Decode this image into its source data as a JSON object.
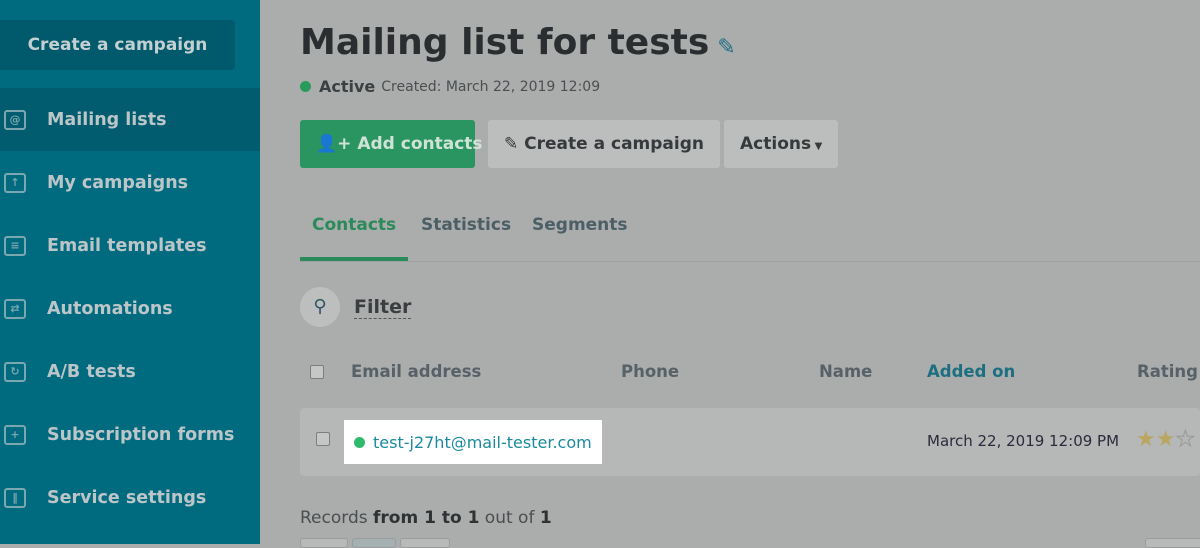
{
  "sidebar": {
    "create_button": "Create a campaign",
    "items": [
      {
        "label": "Mailing lists",
        "icon": "address-book-icon",
        "active": true
      },
      {
        "label": "My campaigns",
        "icon": "upload-icon"
      },
      {
        "label": "Email templates",
        "icon": "template-icon"
      },
      {
        "label": "Automations",
        "icon": "automation-icon"
      },
      {
        "label": "A/B tests",
        "icon": "ab-test-icon"
      },
      {
        "label": "Subscription forms",
        "icon": "form-icon"
      },
      {
        "label": "Service settings",
        "icon": "sliders-icon"
      }
    ]
  },
  "header": {
    "title": "Mailing list for tests",
    "status": "Active",
    "created": "Created: March 22, 2019 12:09"
  },
  "actions": {
    "add_contacts": "Add contacts",
    "create_campaign": "Create a campaign",
    "actions": "Actions"
  },
  "tabs": [
    "Contacts",
    "Statistics",
    "Segments"
  ],
  "filter": {
    "label": "Filter"
  },
  "table": {
    "headers": [
      "Email address",
      "Phone",
      "Name",
      "Added on",
      "Rating"
    ],
    "rows": [
      {
        "email": "test-j27ht@mail-tester.com",
        "phone": "",
        "name": "",
        "added_on": "March 22, 2019 12:09 PM",
        "rating": 2
      }
    ]
  },
  "records": {
    "prefix": "Records ",
    "range": "from 1 to 1",
    "mid": " out of ",
    "total": "1"
  },
  "colors": {
    "sidebar": "#006a7e",
    "accent_green": "#2a9560",
    "link": "#1a8a9f"
  }
}
